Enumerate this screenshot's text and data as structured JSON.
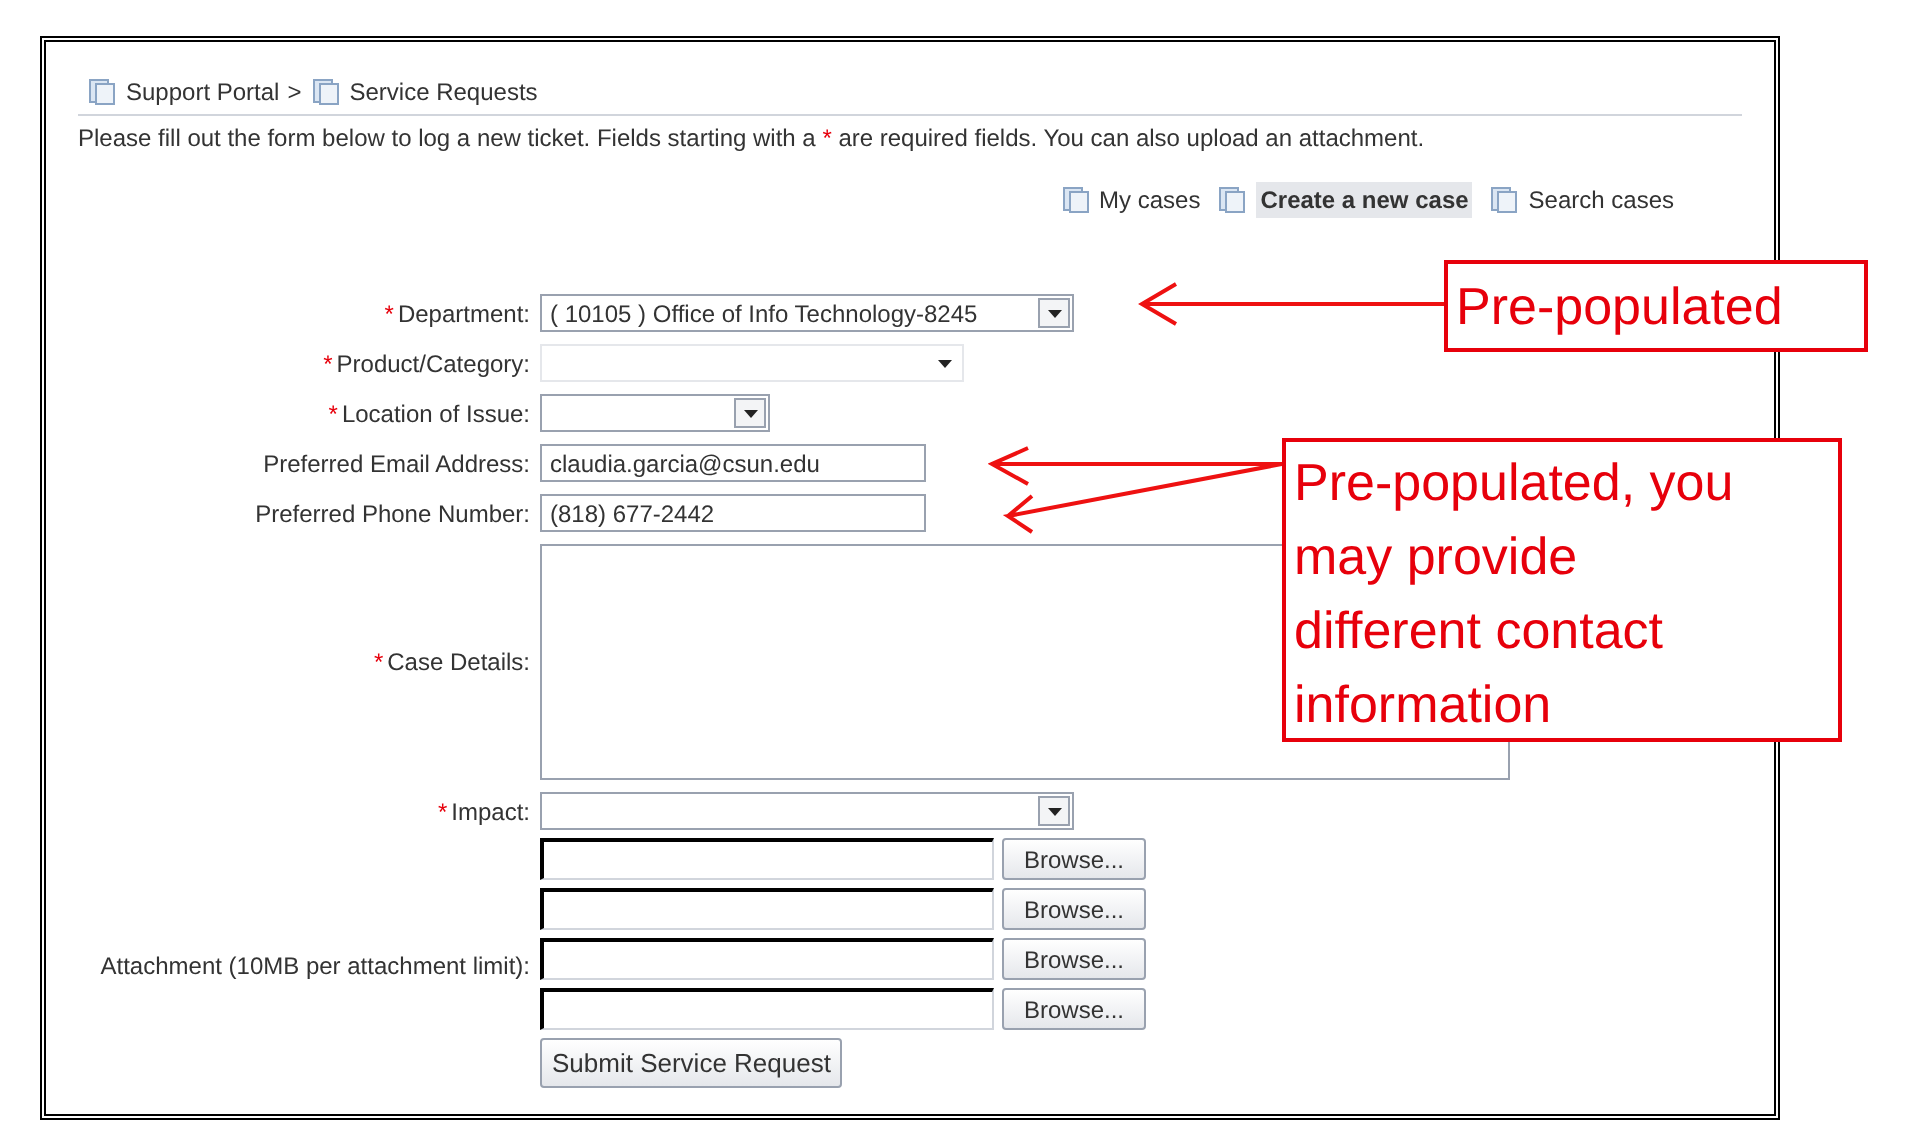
{
  "breadcrumb": [
    {
      "label": "Support Portal",
      "separator": ">"
    },
    {
      "label": "Service Requests"
    }
  ],
  "intro": {
    "before": "Please fill out the form below to log a new ticket. Fields starting with a ",
    "star": "*",
    "after": " are required fields. You can also upload an attachment."
  },
  "nav_links": [
    {
      "label": "My cases",
      "selected": false
    },
    {
      "label": "Create a new case",
      "selected": true
    },
    {
      "label": "Search cases",
      "selected": false
    }
  ],
  "fields": [
    {
      "kind": "select",
      "required_mark": "*",
      "label": "Department:",
      "value": "( 10105 ) Office of Info Technology-8245"
    },
    {
      "kind": "combo",
      "required_mark": "*",
      "label": "Product/Category:"
    },
    {
      "kind": "chooser",
      "required_mark": "*",
      "label": "Location of Issue:"
    },
    {
      "kind": "text",
      "label": "Preferred Email Address:",
      "value": "claudia.garcia@csun.edu"
    },
    {
      "kind": "text",
      "label": "Preferred Phone Number:",
      "value": "(818) 677-2442"
    },
    {
      "kind": "textarea",
      "required_mark": "*",
      "label": "Case Details:"
    },
    {
      "kind": "select",
      "required_mark": "*",
      "label": "Impact:"
    }
  ],
  "attachments": {
    "label": "Attachment (10MB per attachment limit):",
    "rows": [
      {
        "button": "Browse..."
      },
      {
        "button": "Browse..."
      },
      {
        "button": "Browse..."
      },
      {
        "button": "Browse..."
      }
    ]
  },
  "submit": "Submit Service Request",
  "callouts": [
    {
      "text": "Pre-populated"
    },
    {
      "text": "Pre-populated, you may provide different contact information"
    }
  ]
}
